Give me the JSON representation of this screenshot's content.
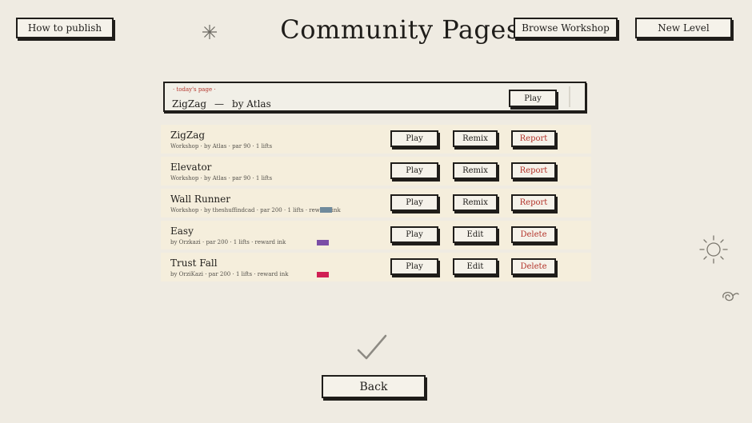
{
  "header": {
    "title": "Community Pages",
    "how_to_publish": "How to publish",
    "browse_workshop": "Browse Workshop",
    "new_level": "New Level"
  },
  "today": {
    "tag": "· today's page ·",
    "level": "ZigZag",
    "separator": "—",
    "author": "by Atlas",
    "play": "Play"
  },
  "levels": [
    {
      "name": "ZigZag",
      "meta": "Workshop · by Atlas · par 90 · 1 lifts",
      "actions": [
        "Play",
        "Remix",
        "Report"
      ]
    },
    {
      "name": "Elevator",
      "meta": "Workshop · by Atlas · par 90 · 1 lifts",
      "actions": [
        "Play",
        "Remix",
        "Report"
      ]
    },
    {
      "name": "Wall Runner",
      "meta": "Workshop · by theshuffindcad · par 200 · 1 lifts · rew",
      "meta_tail": "ink",
      "swatch": "#6f8a9c",
      "actions": [
        "Play",
        "Remix",
        "Report"
      ]
    },
    {
      "name": "Easy",
      "meta": "by Orzkazi · par 200 · 1 lifts · reward ink",
      "swatch": "#7b4ea6",
      "actions": [
        "Play",
        "Edit",
        "Delete"
      ]
    },
    {
      "name": "Trust Fall",
      "meta": "by OrziKazi · par 200 · 1 lifts · reward ink",
      "swatch": "#d01f54",
      "actions": [
        "Play",
        "Edit",
        "Delete"
      ]
    }
  ],
  "footer": {
    "back": "Back"
  },
  "colors": {
    "background": "#efebe2",
    "row": "#f5eedc",
    "ink": "#1f1d1a",
    "danger": "#b4352c"
  }
}
